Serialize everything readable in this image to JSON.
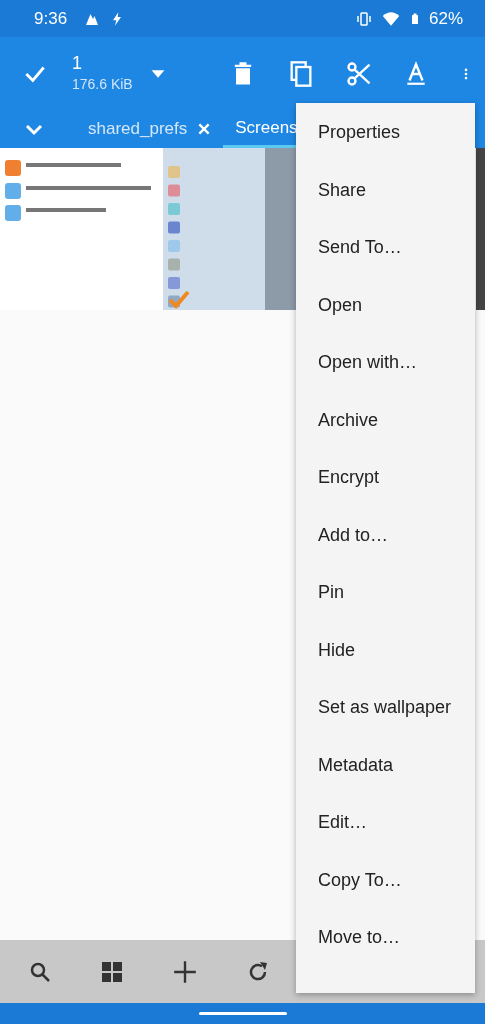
{
  "status_bar": {
    "time": "9:36",
    "battery": "62%"
  },
  "toolbar": {
    "count": "1",
    "size": "176.6 KiB"
  },
  "tabs": [
    {
      "label": "shared_prefs",
      "selected": false,
      "closable": true
    },
    {
      "label": "Screens",
      "selected": true,
      "closable": false
    }
  ],
  "menu": {
    "items": [
      "Properties",
      "Share",
      "Send To…",
      "Open",
      "Open with…",
      "Archive",
      "Encrypt",
      "Add to…",
      "Pin",
      "Hide",
      "Set as wallpaper",
      "Metadata",
      "Edit…",
      "Copy To…",
      "Move to…"
    ]
  }
}
